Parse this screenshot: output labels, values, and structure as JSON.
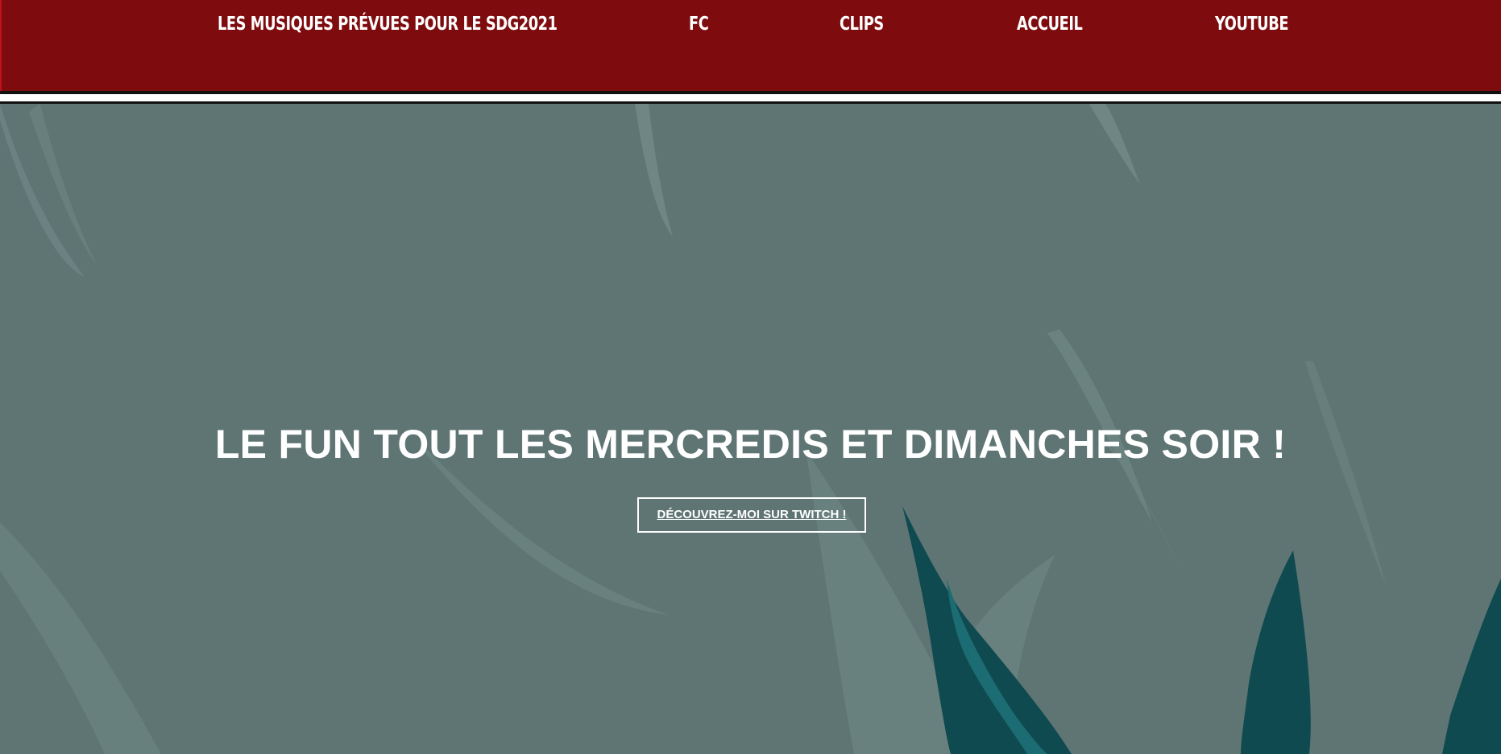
{
  "nav": {
    "items": [
      {
        "label": "LES MUSIQUES PRÉVUES POUR LE SDG2021"
      },
      {
        "label": "FC"
      },
      {
        "label": "CLIPS"
      },
      {
        "label": "ACCUEIL"
      },
      {
        "label": "YOUTUBE"
      }
    ]
  },
  "hero": {
    "headline": "LE FUN TOUT LES MERCREDIS ET DIMANCHES SOIR !",
    "cta_label": "DÉCOUVREZ-MOI SUR TWITCH !"
  },
  "colors": {
    "header_bg": "#7e0c0f",
    "hero_bg": "#5f7574",
    "accent_dark_teal": "#0f4a50"
  }
}
